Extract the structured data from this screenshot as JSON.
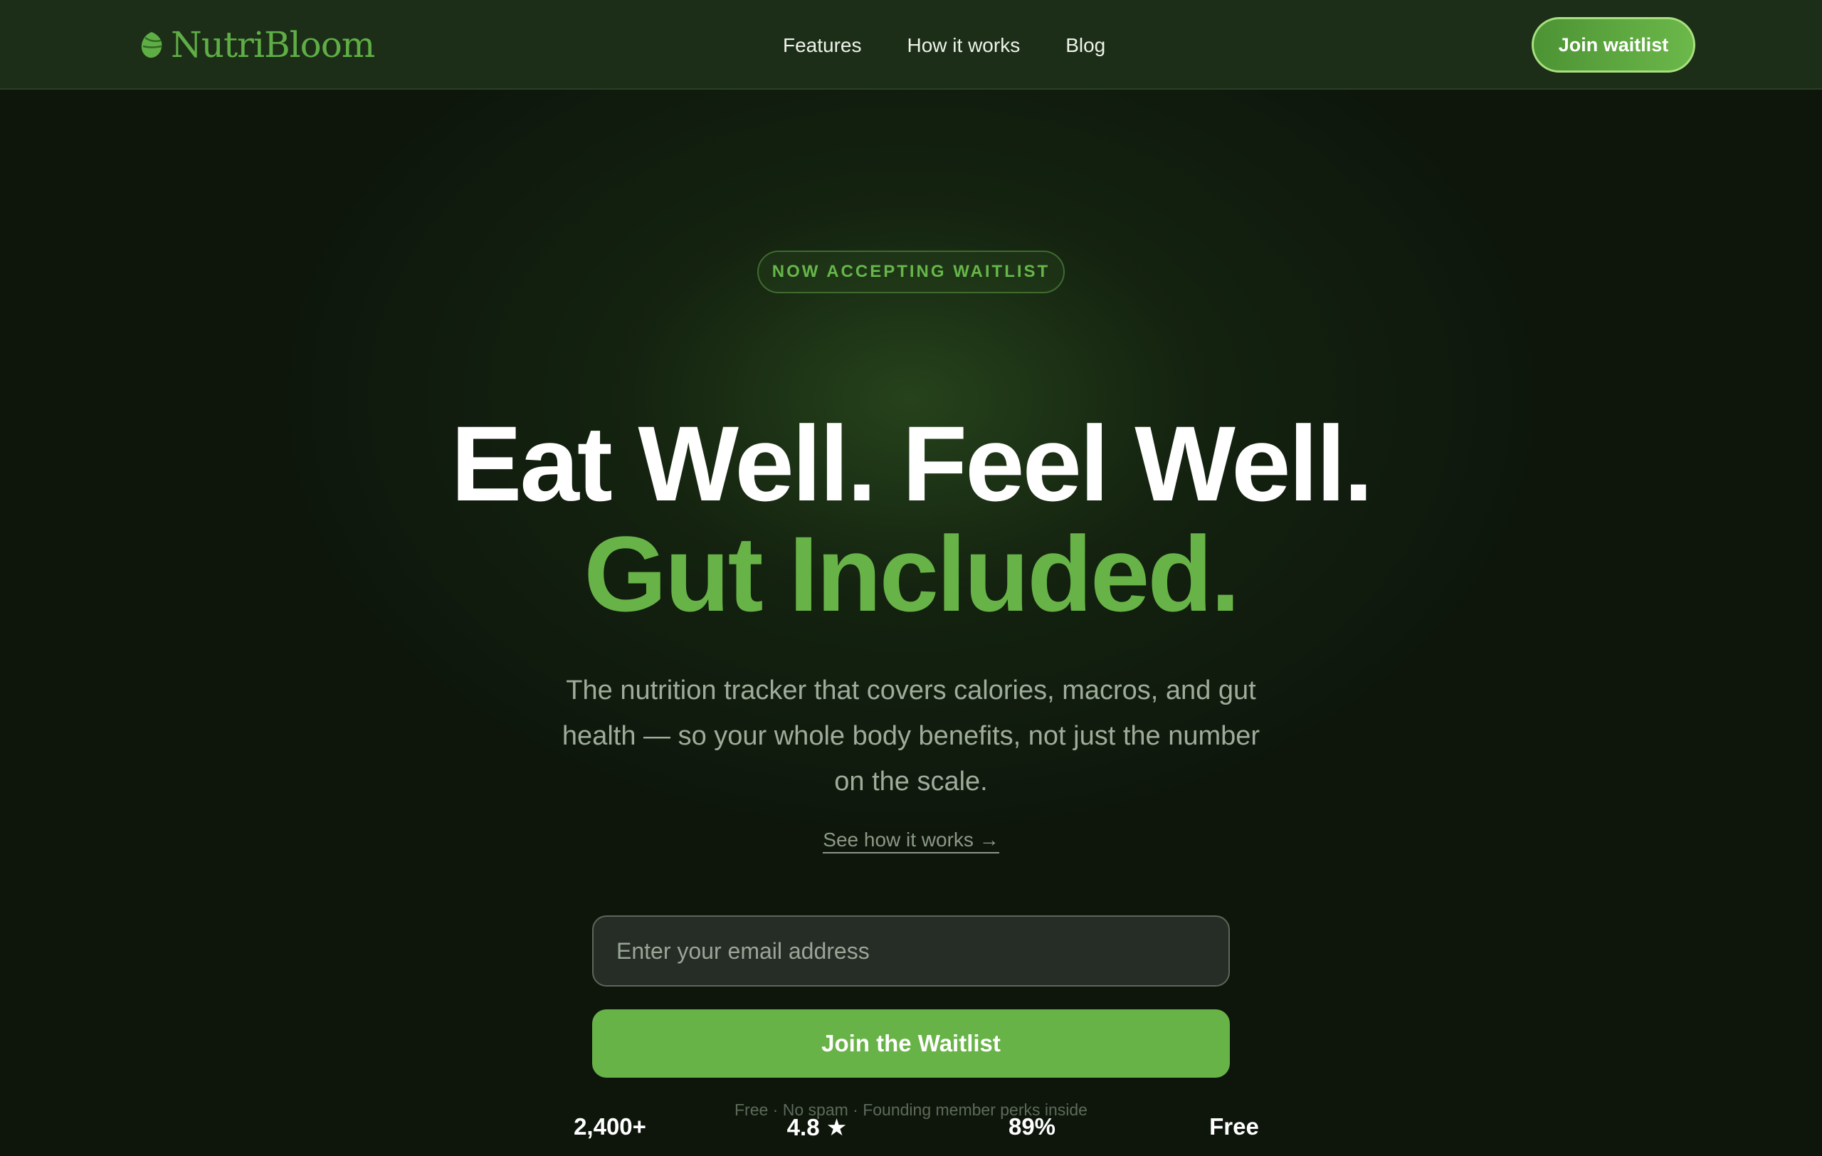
{
  "brand": {
    "name": "NutriBloom",
    "accent_color": "#68b347",
    "background_color": "#0e160c"
  },
  "nav": {
    "links": [
      {
        "label": "Features"
      },
      {
        "label": "How it works"
      },
      {
        "label": "Blog"
      }
    ],
    "cta_label": "Join waitlist"
  },
  "hero": {
    "badge": "NOW ACCEPTING WAITLIST",
    "headline": "Eat Well. Feel Well.",
    "headline_accent": "Gut Included.",
    "subheadline": "The nutrition tracker that covers calories, macros, and gut health — so your whole body benefits, not just the number on the scale.",
    "secondary_link": "See how it works →"
  },
  "signup": {
    "email_placeholder": "Enter your email address",
    "submit_label": "Join the Waitlist",
    "fineprint": "Free · No spam · Founding member perks inside"
  },
  "stats": [
    {
      "value": "2,400+"
    },
    {
      "value": "4.8 ★"
    },
    {
      "value": "89%"
    },
    {
      "value": "Free"
    }
  ]
}
